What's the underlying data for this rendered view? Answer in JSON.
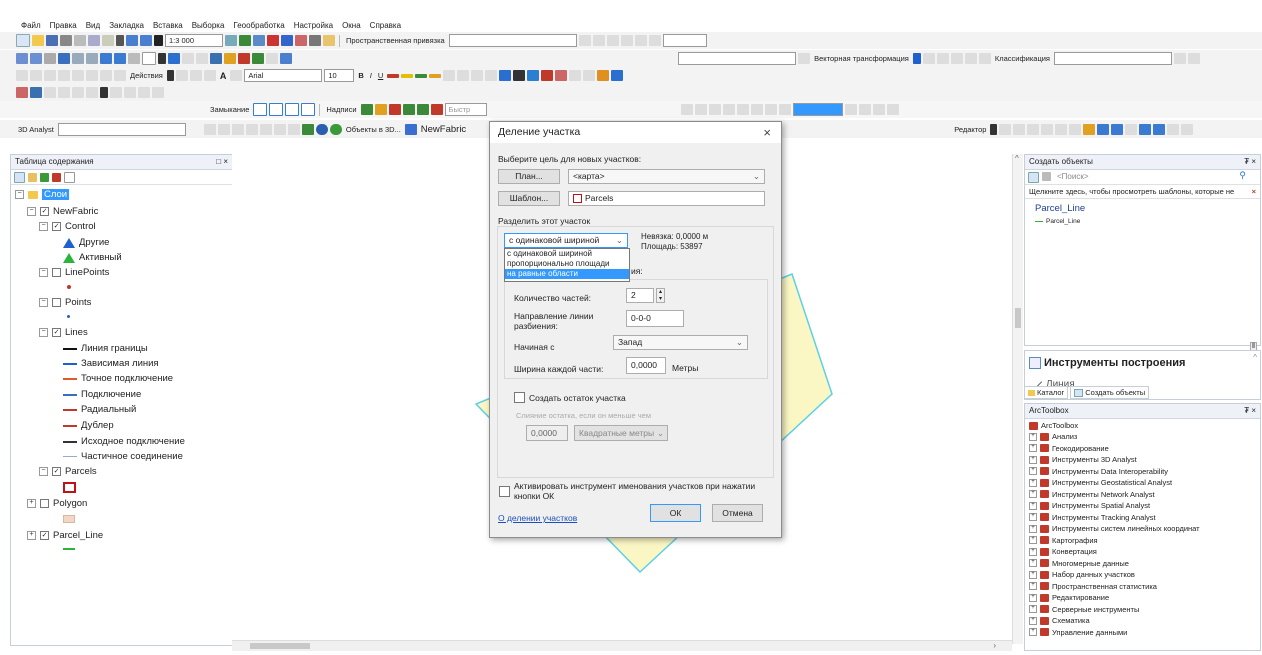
{
  "menu": [
    "Файл",
    "Правка",
    "Вид",
    "Закладка",
    "Вставка",
    "Выборка",
    "Геообработка",
    "Настройка",
    "Окна",
    "Справка"
  ],
  "toolbar": {
    "scale": "1:3 000",
    "spatial_adjustment": "Пространственная привязка",
    "vector_transform": "Векторная трансформация",
    "classification": "Классификация",
    "actions": "Действия",
    "font": "Arial",
    "font_size": "10",
    "font_bold": "B",
    "font_italic": "I",
    "font_underline": "U",
    "closure": "Замыкание",
    "labels": "Надписи",
    "fast_label": "Быстр",
    "analyst_3d": "3D Analyst",
    "objects_3d": "Объекты в 3D...",
    "newfabric": "NewFabric",
    "editor": "Редактор"
  },
  "toc": {
    "title": "Таблица содержания",
    "close": "□ ×",
    "root": "Слои",
    "items": {
      "newfabric": "NewFabric",
      "control": "Control",
      "control_other": "Другие",
      "control_active": "Активный",
      "linepoints": "LinePoints",
      "points": "Points",
      "lines": "Lines",
      "line_border": "Линия границы",
      "line_dependent": "Зависимая линия",
      "line_precise": "Точное подключение",
      "line_connection": "Подключение",
      "line_radial": "Радиальный",
      "line_duplicate": "Дублер",
      "line_source": "Исходное подключение",
      "line_partial": "Частичное соединение",
      "parcels": "Parcels",
      "polygon": "Polygon",
      "parcel_line": "Parcel_Line"
    }
  },
  "dialog": {
    "title": "Деление участка",
    "close": "×",
    "target_label": "Выберите цель для новых участков:",
    "plan_button": "План...",
    "plan_value": "<карта>",
    "template_button": "Шаблон...",
    "template_value": "Parcels",
    "split_group": "Разделить этот участок",
    "method_selected": "с одинаковой шириной",
    "method_options": [
      "с одинаковой шириной",
      "пропорционально площади",
      "на равные области"
    ],
    "misclosure": "Невязка: 0,0000 м",
    "area": "Площадь: 53897",
    "hidden_label_tail": "ия:",
    "parts_label": "Количество частей:",
    "parts_value": "2",
    "direction_label": "Направление линии разбиения:",
    "direction_value": "0-0-0",
    "start_label": "Начиная с",
    "start_value": "Запад",
    "width_label": "Ширина каждой части:",
    "width_value": "0,0000",
    "width_unit": "Метры",
    "remainder_label": "Создать остаток участка",
    "merge_label": "Слияние остатка, если он меньше чем",
    "merge_value": "0,0000",
    "merge_unit": "Квадратные метры",
    "activate_label": "Активировать инструмент именования участков при нажатии кнопки ОК",
    "help_link": "О делении участков",
    "ok": "ОК",
    "cancel": "Отмена"
  },
  "create_features": {
    "title": "Создать объекты",
    "pin": "₮ ×",
    "search": "<Поиск>",
    "hint": "Щелкните здесь, чтобы просмотреть шаблоны, которые не",
    "group": "Parcel_Line",
    "item": "Parcel_Line"
  },
  "construction": {
    "title": "Инструменты построения",
    "line": "Линия"
  },
  "tabs": {
    "catalog": "Каталог",
    "create": "Создать объекты"
  },
  "arctoolbox": {
    "title": "ArcToolbox",
    "pin": "₮ ×",
    "root": "ArcToolbox",
    "items": [
      "Анализ",
      "Геокодирование",
      "Инструменты 3D Analyst",
      "Инструменты Data Interoperability",
      "Инструменты Geostatistical Analyst",
      "Инструменты Network Analyst",
      "Инструменты Spatial Analyst",
      "Инструменты Tracking Analyst",
      "Инструменты систем линейных координат",
      "Картография",
      "Конвертация",
      "Многомерные данные",
      "Набор данных участков",
      "Пространственная статистика",
      "Редактирование",
      "Серверные инструменты",
      "Схематика",
      "Управление данными"
    ]
  },
  "colors": {
    "parcel_fill": "#fbf7c4",
    "parcel_stroke": "#5bd0e8",
    "selection": "#3399ff",
    "active_green": "#2bb43a",
    "other_blue": "#1f5fd0"
  }
}
